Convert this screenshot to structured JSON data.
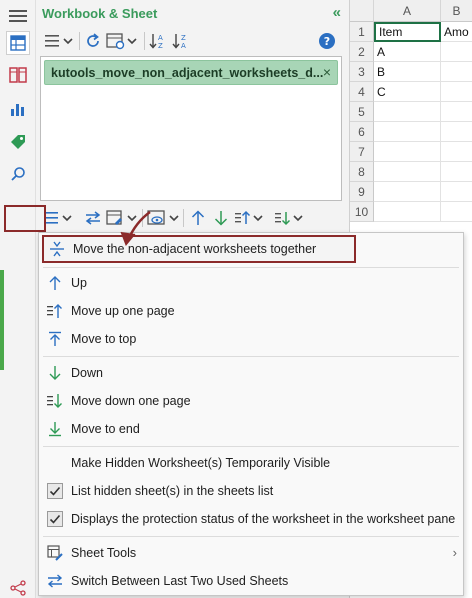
{
  "pane": {
    "title": "Workbook & Sheet",
    "collapse_glyph": "«",
    "selected_sheet": "kutools_move_non_adjacent_worksheets_d...",
    "tag_close_glyph": "×"
  },
  "sheet": {
    "columns": [
      "A",
      "B"
    ],
    "rows": [
      "1",
      "2",
      "3",
      "4",
      "5",
      "6",
      "7",
      "8",
      "9",
      "10"
    ],
    "cells": {
      "A1": "Item",
      "B1": "Amo",
      "A2": "A",
      "A3": "B",
      "A4": "C"
    }
  },
  "menu": {
    "items": [
      {
        "label": "Move the non-adjacent worksheets together",
        "icon": "collapse-vertical-icon"
      },
      {
        "label": "Up",
        "icon": "arrow-up-icon"
      },
      {
        "label": "Move up one page",
        "icon": "page-up-icon"
      },
      {
        "label": "Move to top",
        "icon": "move-top-icon"
      },
      {
        "label": "Down",
        "icon": "arrow-down-icon"
      },
      {
        "label": "Move down one page",
        "icon": "page-down-icon"
      },
      {
        "label": "Move to end",
        "icon": "move-end-icon"
      },
      {
        "label": "Make Hidden Worksheet(s) Temporarily Visible",
        "icon": ""
      },
      {
        "label": "List hidden sheet(s) in the sheets list",
        "checked": true
      },
      {
        "label": "Displays the protection status of the worksheet in the worksheet pane",
        "checked": true
      },
      {
        "label": "Sheet Tools",
        "icon": "sheet-tools-icon",
        "submenu_glyph": "›"
      },
      {
        "label": "Switch Between Last Two Used Sheets",
        "icon": "switch-icon"
      }
    ]
  },
  "colors": {
    "accent_green": "#3a9b5c",
    "tag_bg": "#a8d5b6",
    "highlight_red": "#8b2a2a",
    "icon_blue": "#2b6fc2",
    "icon_green": "#2e9a55"
  }
}
